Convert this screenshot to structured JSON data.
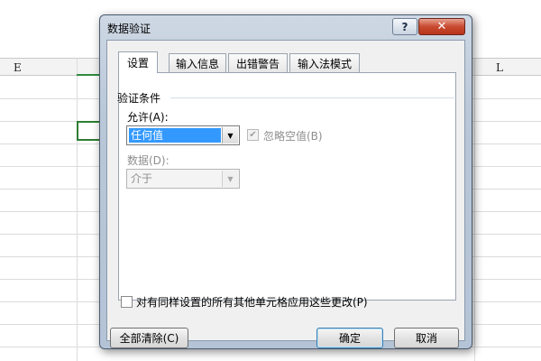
{
  "sheet": {
    "columns": [
      {
        "label": "E"
      },
      {
        "label": "L"
      }
    ]
  },
  "dialog": {
    "title": "数据验证",
    "help_label": "?",
    "close_label": "✕",
    "tabs": [
      {
        "label": "设置",
        "active": true
      },
      {
        "label": "输入信息",
        "active": false
      },
      {
        "label": "出错警告",
        "active": false
      },
      {
        "label": "输入法模式",
        "active": false
      }
    ],
    "settings": {
      "group_title": "验证条件",
      "allow_label": "允许(A):",
      "allow_value": "任何值",
      "ignore_blank_label": "忽略空值(B)",
      "ignore_blank_checked": true,
      "data_label": "数据(D):",
      "data_value": "介于",
      "apply_all_label": "对有同样设置的所有其他单元格应用这些更改(P)",
      "apply_all_checked": false
    },
    "buttons": {
      "clear_all": "全部清除(C)",
      "ok": "确定",
      "cancel": "取消"
    },
    "icons": {
      "dropdown": "chevron-down-icon",
      "check": "checkmark-icon"
    }
  }
}
